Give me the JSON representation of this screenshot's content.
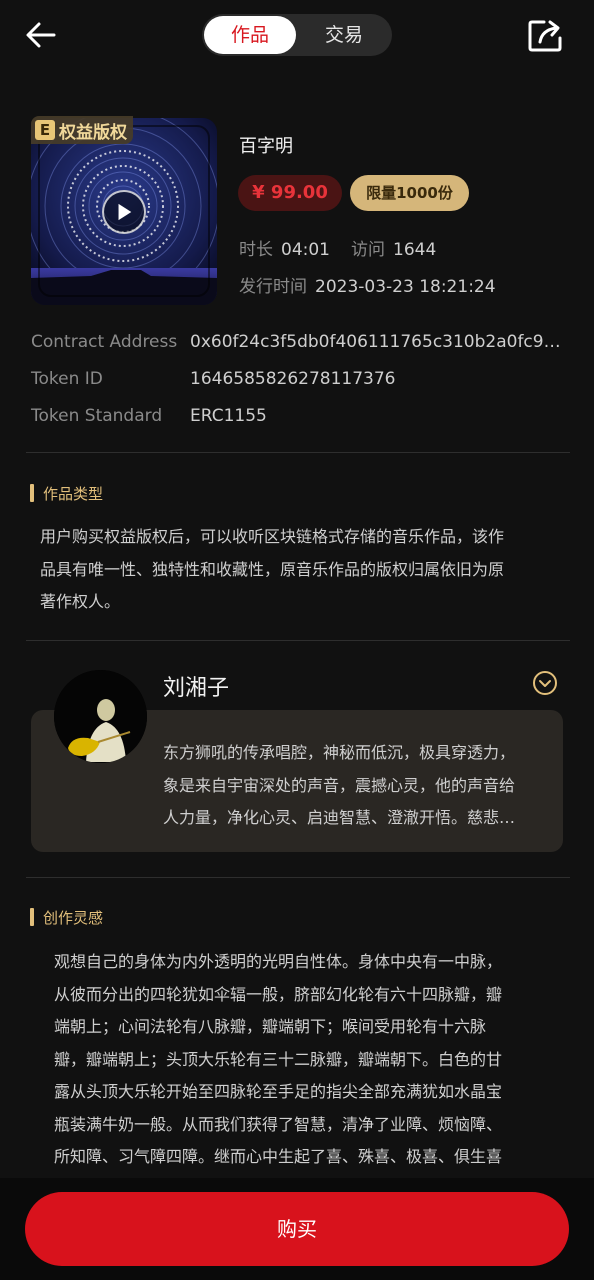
{
  "header": {
    "tabs": [
      {
        "label": "作品",
        "active": true
      },
      {
        "label": "交易",
        "active": false
      }
    ]
  },
  "product": {
    "badge_letter": "E",
    "badge_label": "权益版权",
    "title": "百字明",
    "price": "¥ 99.00",
    "limit": "限量1000份",
    "duration_label": "时长",
    "duration": "04:01",
    "visits_label": "访问",
    "visits": "1644",
    "release_label": "发行时间",
    "release_time": "2023-03-23 18:21:24"
  },
  "chain": {
    "contract_label": "Contract Address",
    "contract_value": "0x60f24c3f5db0f406111765c310b2a0fc907d…",
    "token_id_label": "Token ID",
    "token_id_value": "1646585826278117376",
    "standard_label": "Token Standard",
    "standard_value": "ERC1155"
  },
  "work_type": {
    "title": "作品类型",
    "lines": [
      "用户购买权益版权后，可以收听区块链格式存储的音乐作品，该作",
      "品具有唯一性、独特性和收藏性，原音乐作品的版权归属依旧为原",
      "著作权人。"
    ]
  },
  "artist": {
    "name": "刘湘子",
    "bio_lines": [
      "东方狮吼的传承唱腔，神秘而低沉，极具穿透力，",
      "象是来自宇宙深处的声音，震撼心灵，他的声音给",
      "人力量，净化心灵、启迪智慧、澄澈开悟。慈悲…"
    ]
  },
  "inspiration": {
    "title": "创作灵感",
    "lines": [
      "观想自己的身体为内外透明的光明自性体。身体中央有一中脉，",
      "从彼而分出的四轮犹如伞辐一般，脐部幻化轮有六十四脉瓣，瓣",
      "端朝上；心间法轮有八脉瓣，瓣端朝下；喉间受用轮有十六脉",
      "瓣，瓣端朝上；头顶大乐轮有三十二脉瓣，瓣端朝下。白色的甘",
      "露从头顶大乐轮开始至四脉轮至手足的指尖全部充满犹如水晶宝",
      "瓶装满牛奶一般。从而我们获得了智慧，清净了业障、烦恼障、",
      "所知障、习气障四障。继而心中生起了喜、殊喜、极喜、俱生喜"
    ]
  },
  "actions": {
    "buy_label": "购买"
  },
  "colors": {
    "accent_red": "#d8121c",
    "gold": "#e2bf7b"
  }
}
